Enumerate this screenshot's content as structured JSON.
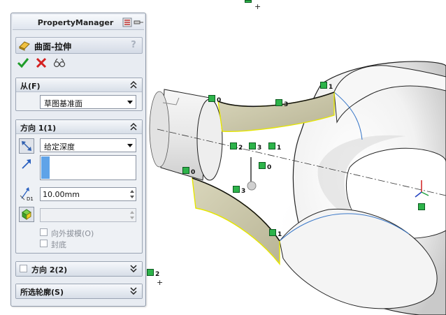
{
  "property_manager": {
    "title": "PropertyManager",
    "feature_title": "曲面-拉伸",
    "help": "?",
    "from": {
      "title": "从(F)",
      "start_condition": "草图基准面"
    },
    "direction1": {
      "title": "方向 1(1)",
      "end_condition": "给定深度",
      "depth": "10.00mm",
      "depth_symbol": "D1",
      "draft_outward_label": "向外拔模(O)",
      "cap_end_label": "封底"
    },
    "direction2": {
      "title": "方向 2(2)"
    },
    "selected_contours": {
      "title": "所选轮廓(S)"
    }
  },
  "viewport": {
    "markers": [
      {
        "label": "0"
      },
      {
        "label": "3"
      },
      {
        "label": "1"
      },
      {
        "label": "2"
      },
      {
        "label": "3"
      },
      {
        "label": "1"
      },
      {
        "label": "0"
      },
      {
        "label": "0"
      },
      {
        "label": "3"
      },
      {
        "label": "1"
      },
      {
        "label": "2"
      },
      {
        "label": ""
      }
    ]
  },
  "colors": {
    "accent_green": "#2db34a",
    "ok_green": "#1f9d2a",
    "cancel_red": "#d42020",
    "panel_bg": "#e8ecf2",
    "surface_fill": "#c8c4a6",
    "selection_yellow": "#e6e600",
    "edge_blue": "#3a78c8"
  }
}
